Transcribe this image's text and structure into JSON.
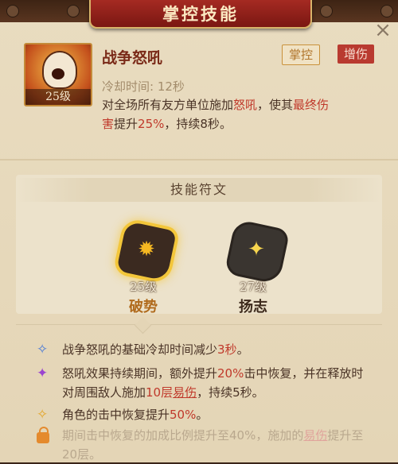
{
  "header": {
    "title": "掌控技能",
    "close_glyph": "×"
  },
  "skill": {
    "level": "25级",
    "name": "战争怒吼",
    "tags": [
      "掌控",
      "增伤"
    ],
    "cooldown": "冷却时间: 12秒",
    "desc": {
      "p1": "对全场所有友方单位施加",
      "roar": "怒吼",
      "p2": "，使其",
      "final": "最终伤",
      "final2": "害",
      "p3": "提升",
      "pct": "25%",
      "p4": "，持续",
      "dur": "8秒",
      "p5": "。"
    }
  },
  "runes": {
    "header": "技能符文",
    "items": [
      {
        "level": "25级",
        "name": "破势",
        "icon": "flame-rune-icon"
      },
      {
        "level": "27级",
        "name": "扬志",
        "icon": "star-rune-icon"
      }
    ]
  },
  "effects": [
    {
      "a": "战争怒吼的基础冷却时间减少",
      "v": "3秒",
      "b": "。"
    },
    {
      "a": "怒吼效果持续期间，额外提升",
      "v": "20%",
      "b": "击中恢复，并在释放时对周围敌人施加",
      "v2": "10层",
      "c": "易伤",
      "d": "，持续5秒。"
    },
    {
      "a": "角色的击中恢复提升",
      "v": "50%",
      "b": "。"
    },
    {
      "a": "期间击中恢复的加成比例提升至40%，施加的",
      "c": "易伤",
      "d": "提升至20层。"
    }
  ],
  "colors": {
    "accent_red": "#c0392b",
    "banner": "#a52a22",
    "gold": "#f3c63a"
  }
}
